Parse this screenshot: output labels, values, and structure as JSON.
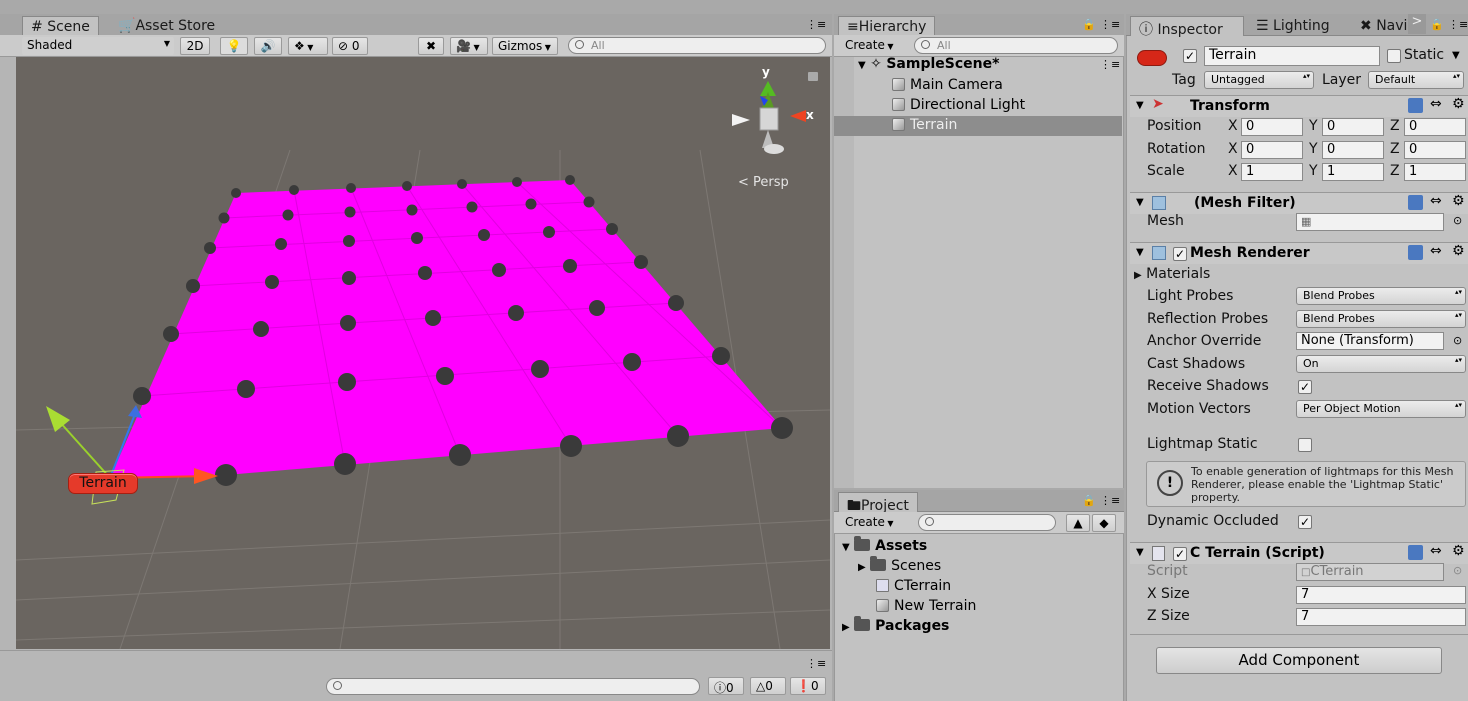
{
  "scene_panel": {
    "tabs": [
      {
        "label": "Scene"
      },
      {
        "label": "Asset Store"
      }
    ],
    "toolbar": {
      "shading_mode": "Shaded",
      "mode_2d": "2D",
      "hidden_count": "0",
      "gizmos": "Gizmos",
      "search_placeholder": "All"
    },
    "gizmo": {
      "y_label": "y",
      "x_label": "x",
      "projection": "Persp"
    },
    "selected_label": "Terrain",
    "status": {
      "messages": "0",
      "warnings": "0",
      "errors": "0"
    },
    "colors": {
      "terrain": "#ff00ff",
      "viewport_bg": "#6a6560",
      "points": "#3a3a3a"
    }
  },
  "hierarchy": {
    "tab": "Hierarchy",
    "create": "Create",
    "search_placeholder": "All",
    "scene": "SampleScene*",
    "items": [
      {
        "label": "Main Camera"
      },
      {
        "label": "Directional Light"
      },
      {
        "label": "Terrain",
        "selected": true
      }
    ]
  },
  "project": {
    "tab": "Project",
    "create": "Create",
    "tree": {
      "assets": "Assets",
      "scenes": "Scenes",
      "cterrain": "CTerrain",
      "new_terrain": "New Terrain",
      "packages": "Packages"
    }
  },
  "inspector": {
    "tabs": [
      {
        "label": "Inspector"
      },
      {
        "label": "Lighting"
      },
      {
        "label": "Navi"
      }
    ],
    "object_name": "Terrain",
    "static_label": "Static",
    "tag_label": "Tag",
    "tag_value": "Untagged",
    "layer_label": "Layer",
    "layer_value": "Default",
    "transform": {
      "title": "Transform",
      "position_label": "Position",
      "rotation_label": "Rotation",
      "scale_label": "Scale",
      "axis_x": "X",
      "axis_y": "Y",
      "axis_z": "Z",
      "position": [
        "0",
        "0",
        "0"
      ],
      "rotation": [
        "0",
        "0",
        "0"
      ],
      "scale": [
        "1",
        "1",
        "1"
      ]
    },
    "mesh_filter": {
      "title": "(Mesh Filter)",
      "mesh_label": "Mesh"
    },
    "mesh_renderer": {
      "title": "Mesh Renderer",
      "materials": "Materials",
      "light_probes_label": "Light Probes",
      "light_probes_value": "Blend Probes",
      "reflection_probes_label": "Reflection Probes",
      "reflection_probes_value": "Blend Probes",
      "anchor_override_label": "Anchor Override",
      "anchor_override_value": "None (Transform)",
      "cast_shadows_label": "Cast Shadows",
      "cast_shadows_value": "On",
      "receive_shadows_label": "Receive Shadows",
      "motion_vectors_label": "Motion Vectors",
      "motion_vectors_value": "Per Object Motion",
      "lightmap_static_label": "Lightmap Static",
      "info": "To enable generation of lightmaps for this Mesh Renderer, please enable the 'Lightmap Static' property.",
      "dynamic_occluded_label": "Dynamic Occluded"
    },
    "script": {
      "title": "C Terrain (Script)",
      "script_label": "Script",
      "script_value": "CTerrain",
      "x_size_label": "X Size",
      "x_size_value": "7",
      "z_size_label": "Z Size",
      "z_size_value": "7"
    },
    "add_component": "Add Component"
  }
}
